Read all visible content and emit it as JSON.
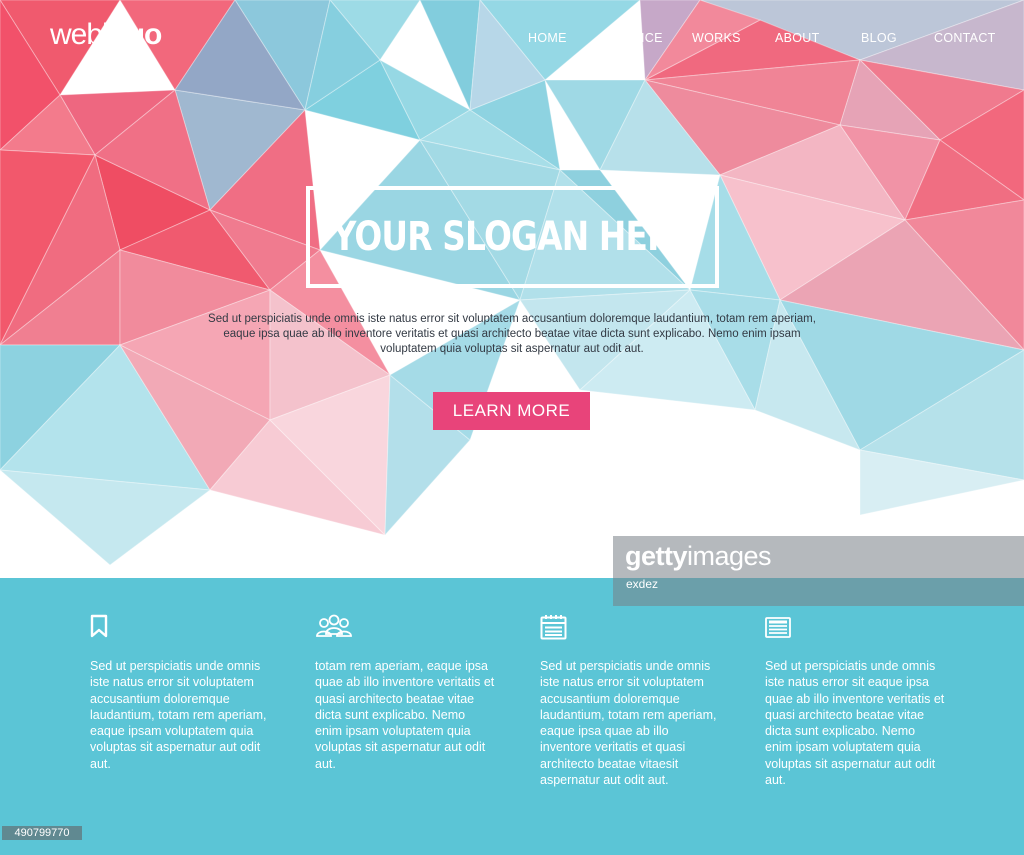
{
  "header": {
    "logo_light": "web",
    "logo_bold": "logo",
    "nav": [
      "HOME",
      "SERVICE",
      "WORKS",
      "ABOUT",
      "BLOG",
      "CONTACT"
    ]
  },
  "hero": {
    "slogan": "YOUR SLOGAN HERE",
    "text": "Sed ut perspiciatis unde omnis iste natus error sit voluptatem accusantium doloremque laudantium, totam rem aperiam, eaque ipsa quae ab illo inventore veritatis et quasi architecto beatae vitae dicta sunt explicabo. Nemo enim ipsam voluptatem quia voluptas sit aspernatur aut odit aut.",
    "cta_label": "LEARN MORE"
  },
  "features": [
    {
      "icon": "bookmark-icon",
      "text": "Sed ut perspiciatis unde omnis iste natus error sit voluptatem accusantium doloremque laudantium, totam rem aperiam, eaque ipsam voluptatem quia voluptas sit aspernatur aut odit aut."
    },
    {
      "icon": "users-icon",
      "text": "totam rem aperiam, eaque ipsa quae ab illo inventore veritatis et quasi architecto beatae vitae dicta sunt explicabo. Nemo enim ipsam voluptatem quia voluptas sit aspernatur aut odit aut."
    },
    {
      "icon": "calendar-icon",
      "text": "Sed ut perspiciatis unde omnis iste natus error sit voluptatem accusantium doloremque laudantium, totam rem aperiam, eaque ipsa quae ab illo inventore veritatis et quasi architecto beatae vitaesit aspernatur aut odit aut."
    },
    {
      "icon": "newspaper-icon",
      "text": "Sed ut perspiciatis unde omnis iste natus error sit eaque ipsa quae ab illo inventore veritatis et quasi architecto beatae vitae dicta sunt explicabo. Nemo enim ipsam voluptatem quia voluptas sit aspernatur aut odit aut."
    }
  ],
  "watermark": {
    "brand_bold": "getty",
    "brand_light": "images",
    "credit": "exdez",
    "stock_id": "490799770"
  },
  "colors": {
    "accent_pink": "#e8447a",
    "footer_teal": "#5bc5d6",
    "poly_red": "#f0566a",
    "poly_blue": "#7fd3e0"
  }
}
